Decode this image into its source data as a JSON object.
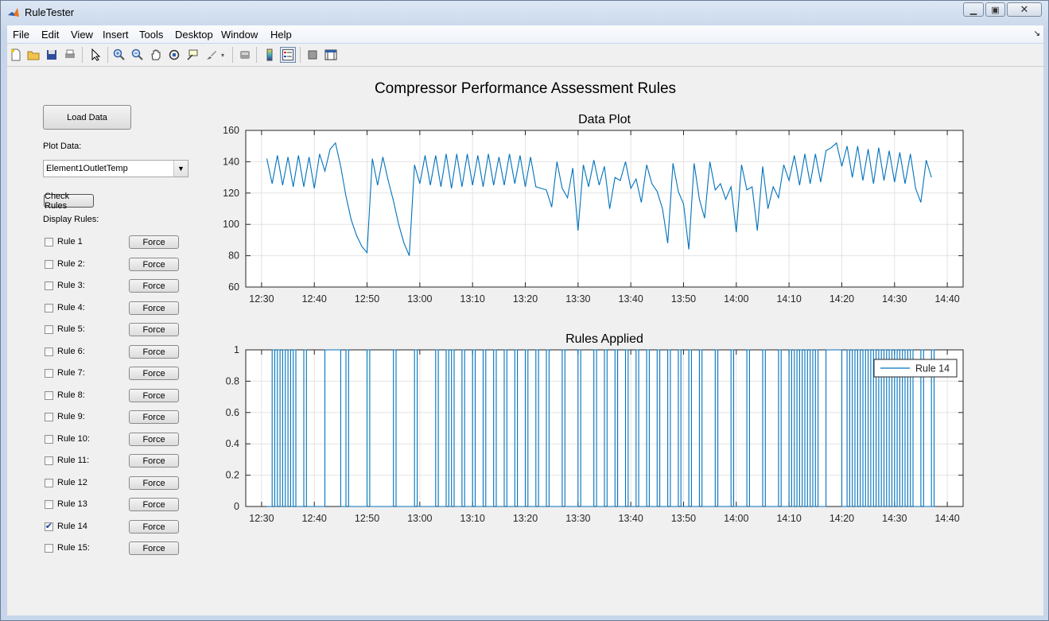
{
  "window": {
    "title": "RuleTester"
  },
  "menu": [
    "File",
    "Edit",
    "View",
    "Insert",
    "Tools",
    "Desktop",
    "Window",
    "Help"
  ],
  "toolbar": {
    "icons": [
      "new-file-icon",
      "open-folder-icon",
      "save-icon",
      "print-icon",
      "pointer-icon",
      "zoom-in-icon",
      "zoom-out-icon",
      "pan-hand-icon",
      "rotate-3d-icon",
      "data-cursor-icon",
      "brush-icon",
      "brush-dropdown-icon",
      "link-plot-icon",
      "colorbar-icon",
      "legend-icon",
      "hide-plot-tools-icon",
      "show-plot-tools-icon"
    ]
  },
  "figure_title": "Compressor Performance Assessment Rules",
  "controls": {
    "load_data_label": "Load Data",
    "plot_data_label": "Plot Data:",
    "plot_data_selected": "Element1OutletTemp",
    "check_rules_label": "Check Rules",
    "display_rules_label": "Display Rules:",
    "force_label": "Force",
    "rules": [
      {
        "label": "Rule 1",
        "checked": false
      },
      {
        "label": "Rule 2:",
        "checked": false
      },
      {
        "label": "Rule 3:",
        "checked": false
      },
      {
        "label": "Rule 4:",
        "checked": false
      },
      {
        "label": "Rule 5:",
        "checked": false
      },
      {
        "label": "Rule 6:",
        "checked": false
      },
      {
        "label": "Rule 7:",
        "checked": false
      },
      {
        "label": "Rule 8:",
        "checked": false
      },
      {
        "label": "Rule 9:",
        "checked": false
      },
      {
        "label": "Rule 10:",
        "checked": false
      },
      {
        "label": "Rule 11:",
        "checked": false
      },
      {
        "label": "Rule 12",
        "checked": false
      },
      {
        "label": "Rule 13",
        "checked": false
      },
      {
        "label": "Rule 14",
        "checked": true
      },
      {
        "label": "Rule 15:",
        "checked": false
      }
    ]
  },
  "chart_data": [
    {
      "type": "line",
      "title": "Data Plot",
      "ylim": [
        60,
        160
      ],
      "yticks": [
        "60",
        "80",
        "100",
        "120",
        "140",
        "160"
      ],
      "xlim": [
        "12:27",
        "14:43"
      ],
      "xticks": [
        "12:30",
        "12:40",
        "12:50",
        "13:00",
        "13:10",
        "13:20",
        "13:30",
        "13:40",
        "13:50",
        "14:00",
        "14:10",
        "14:20",
        "14:30",
        "14:40"
      ],
      "grid": true,
      "line_color": "#0072bd",
      "series": [
        {
          "x": [
            "12:31",
            "12:32",
            "12:33",
            "12:34",
            "12:35",
            "12:36",
            "12:37",
            "12:38",
            "12:39",
            "12:40",
            "12:41",
            "12:42",
            "12:43",
            "12:44",
            "12:45",
            "12:46",
            "12:47",
            "12:48",
            "12:49",
            "12:50",
            "12:51",
            "12:52",
            "12:53",
            "12:54",
            "12:55",
            "12:56",
            "12:57",
            "12:58",
            "12:59",
            "13:00",
            "13:01",
            "13:02",
            "13:03",
            "13:04",
            "13:05",
            "13:06",
            "13:07",
            "13:08",
            "13:09",
            "13:10",
            "13:11",
            "13:12",
            "13:13",
            "13:14",
            "13:15",
            "13:16",
            "13:17",
            "13:18",
            "13:19",
            "13:20",
            "13:21",
            "13:22",
            "13:23",
            "13:24",
            "13:25",
            "13:26",
            "13:27",
            "13:28",
            "13:29",
            "13:30",
            "13:31",
            "13:32",
            "13:33",
            "13:34",
            "13:35",
            "13:36",
            "13:37",
            "13:38",
            "13:39",
            "13:40",
            "13:41",
            "13:42",
            "13:43",
            "13:44",
            "13:45",
            "13:46",
            "13:47",
            "13:48",
            "13:49",
            "13:50",
            "13:51",
            "13:52",
            "13:53",
            "13:54",
            "13:55",
            "13:56",
            "13:57",
            "13:58",
            "13:59",
            "14:00",
            "14:01",
            "14:02",
            "14:03",
            "14:04",
            "14:05",
            "14:06",
            "14:07",
            "14:08",
            "14:09",
            "14:10",
            "14:11",
            "14:12",
            "14:13",
            "14:14",
            "14:15",
            "14:16",
            "14:17",
            "14:18",
            "14:19",
            "14:20",
            "14:21",
            "14:22",
            "14:23",
            "14:24",
            "14:25",
            "14:26",
            "14:27",
            "14:28",
            "14:29",
            "14:30",
            "14:31",
            "14:32",
            "14:33",
            "14:34",
            "14:35",
            "14:36",
            "14:37"
          ],
          "values": [
            142,
            126,
            144,
            125,
            143,
            124,
            144,
            124,
            143,
            123,
            145,
            134,
            148,
            152,
            137,
            118,
            103,
            93,
            86,
            82,
            142,
            125,
            143,
            128,
            115,
            100,
            88,
            80,
            138,
            126,
            144,
            125,
            144,
            124,
            145,
            123,
            145,
            124,
            145,
            125,
            144,
            124,
            145,
            125,
            143,
            125,
            145,
            126,
            144,
            124,
            143,
            124,
            123,
            122,
            111,
            140,
            123,
            117,
            136,
            96,
            138,
            124,
            141,
            125,
            137,
            110,
            130,
            128,
            140,
            123,
            129,
            114,
            138,
            126,
            121,
            110,
            88,
            139,
            121,
            113,
            84,
            139,
            116,
            104,
            140,
            122,
            126,
            116,
            124,
            95,
            138,
            122,
            124,
            96,
            137,
            110,
            124,
            117,
            138,
            128,
            144,
            125,
            145,
            126,
            145,
            127,
            147,
            149,
            152,
            137,
            150,
            130,
            150,
            128,
            148,
            126,
            149,
            128,
            147,
            127,
            146,
            126,
            145,
            123,
            114,
            141,
            130
          ]
        }
      ]
    },
    {
      "type": "line",
      "title": "Rules Applied",
      "ylim": [
        0,
        1
      ],
      "yticks": [
        "0",
        "0.2",
        "0.4",
        "0.6",
        "0.8",
        "1"
      ],
      "xlim": [
        "12:27",
        "14:43"
      ],
      "xticks": [
        "12:30",
        "12:40",
        "12:50",
        "13:00",
        "13:10",
        "13:20",
        "13:30",
        "13:40",
        "13:50",
        "14:00",
        "14:10",
        "14:20",
        "14:30",
        "14:40"
      ],
      "grid": true,
      "legend_position": "top-right",
      "line_color": "#0072bd",
      "series": [
        {
          "name": "Rule 14",
          "on_intervals": [
            [
              "12:32:00",
              "12:32:30"
            ],
            [
              "12:33:00",
              "12:33:30"
            ],
            [
              "12:34:00",
              "12:34:30"
            ],
            [
              "12:35:00",
              "12:35:30"
            ],
            [
              "12:36:00",
              "12:36:30"
            ],
            [
              "12:38:00",
              "12:38:30"
            ],
            [
              "12:42:00",
              "12:45:00"
            ],
            [
              "12:46:00",
              "12:46:30"
            ],
            [
              "12:50:00",
              "12:50:30"
            ],
            [
              "12:55:00",
              "12:55:30"
            ],
            [
              "12:59:00",
              "12:59:30"
            ],
            [
              "13:03:00",
              "13:03:30"
            ],
            [
              "13:05:00",
              "13:05:30"
            ],
            [
              "13:06:00",
              "13:06:30"
            ],
            [
              "13:08:00",
              "13:08:30"
            ],
            [
              "13:10:00",
              "13:10:30"
            ],
            [
              "13:12:00",
              "13:12:30"
            ],
            [
              "13:14:00",
              "13:14:30"
            ],
            [
              "13:16:00",
              "13:16:30"
            ],
            [
              "13:18:00",
              "13:18:30"
            ],
            [
              "13:20:00",
              "13:20:30"
            ],
            [
              "13:22:00",
              "13:22:30"
            ],
            [
              "13:24:00",
              "13:24:30"
            ],
            [
              "13:27:00",
              "13:27:30"
            ],
            [
              "13:30:00",
              "13:30:30"
            ],
            [
              "13:33:00",
              "13:33:30"
            ],
            [
              "13:35:00",
              "13:35:30"
            ],
            [
              "13:37:00",
              "13:37:30"
            ],
            [
              "13:39:00",
              "13:39:30"
            ],
            [
              "13:41:00",
              "13:41:30"
            ],
            [
              "13:43:00",
              "13:43:30"
            ],
            [
              "13:45:00",
              "13:45:30"
            ],
            [
              "13:47:00",
              "13:47:30"
            ],
            [
              "13:49:00",
              "13:49:30"
            ],
            [
              "13:51:00",
              "13:51:30"
            ],
            [
              "13:53:00",
              "13:53:30"
            ],
            [
              "13:56:00",
              "13:56:30"
            ],
            [
              "13:59:00",
              "13:59:30"
            ],
            [
              "14:02:00",
              "14:02:30"
            ],
            [
              "14:05:00",
              "14:05:30"
            ],
            [
              "14:08:00",
              "14:08:30"
            ],
            [
              "14:10:00",
              "14:10:30"
            ],
            [
              "14:11:00",
              "14:11:30"
            ],
            [
              "14:12:00",
              "14:12:30"
            ],
            [
              "14:13:00",
              "14:13:30"
            ],
            [
              "14:14:00",
              "14:14:30"
            ],
            [
              "14:15:00",
              "14:15:30"
            ],
            [
              "14:17:00",
              "14:20:00"
            ],
            [
              "14:21:00",
              "14:21:30"
            ],
            [
              "14:22:00",
              "14:22:30"
            ],
            [
              "14:23:00",
              "14:23:30"
            ],
            [
              "14:24:00",
              "14:24:30"
            ],
            [
              "14:25:00",
              "14:25:30"
            ],
            [
              "14:26:00",
              "14:26:30"
            ],
            [
              "14:27:00",
              "14:27:30"
            ],
            [
              "14:28:00",
              "14:28:30"
            ],
            [
              "14:29:00",
              "14:29:30"
            ],
            [
              "14:30:00",
              "14:30:30"
            ],
            [
              "14:31:00",
              "14:31:30"
            ],
            [
              "14:32:00",
              "14:32:30"
            ],
            [
              "14:33:00",
              "14:33:30"
            ],
            [
              "14:35:00",
              "14:35:30"
            ],
            [
              "14:37:00",
              "14:37:30"
            ]
          ]
        }
      ]
    }
  ]
}
